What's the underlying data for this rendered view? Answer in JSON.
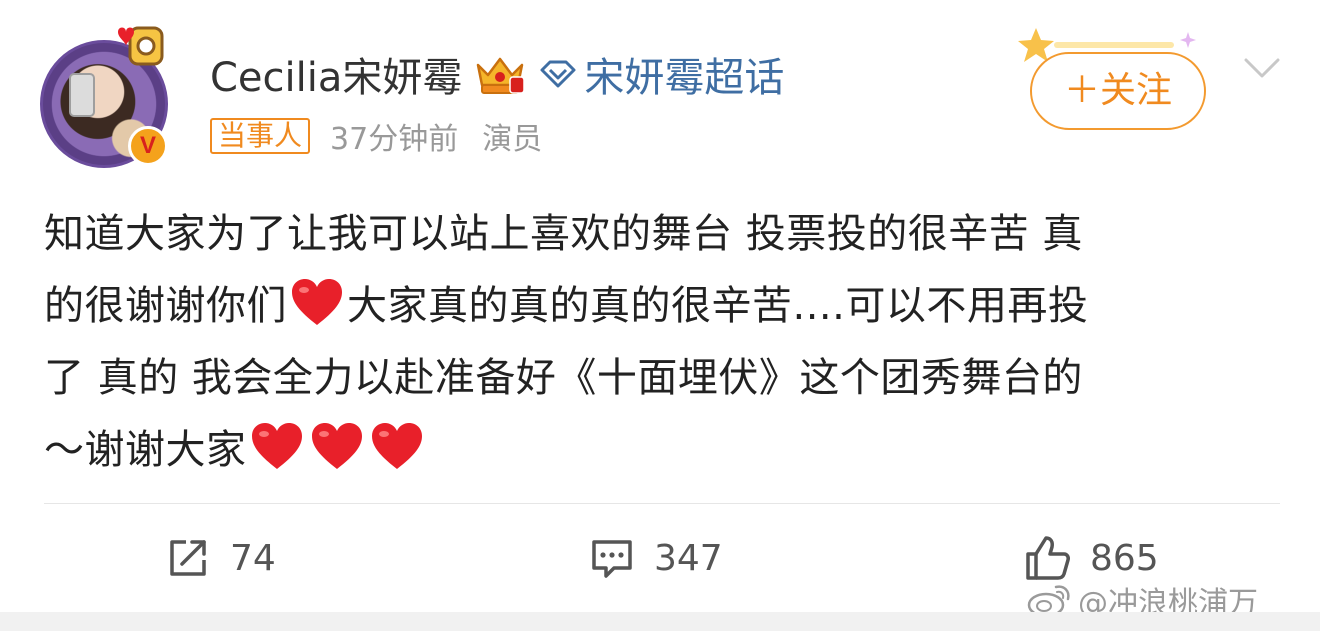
{
  "user": {
    "name": "Cecilia宋妍霉",
    "supertopic": "宋妍霉超话",
    "verify_mark": "V"
  },
  "meta": {
    "tag": "当事人",
    "time": "37分钟前",
    "source": "演员"
  },
  "follow": {
    "label": "＋关注"
  },
  "post": {
    "line1": "知道大家为了让我可以站上喜欢的舞台 投票投的很辛苦 真",
    "line2_a": "的很谢谢你们",
    "line2_b": "大家真的真的真的很辛苦....可以不用再投",
    "line3": "了 真的  我会全力以赴准备好《十面埋伏》这个团秀舞台的",
    "line4": "～谢谢大家"
  },
  "actions": {
    "reposts": "74",
    "comments": "347",
    "likes": "865"
  },
  "watermark": {
    "text": "@冲浪桃浦万"
  },
  "colors": {
    "accent_orange": "#f08a1f",
    "supertopic_blue": "#3f6ea3",
    "heart_red": "#e8202a",
    "text_main": "#222222",
    "text_muted": "#999999"
  },
  "icons": [
    "crown-icon",
    "diamond-icon",
    "heart-icon",
    "repost-icon",
    "comment-icon",
    "like-icon",
    "chevron-down-icon",
    "weibo-logo-icon"
  ]
}
